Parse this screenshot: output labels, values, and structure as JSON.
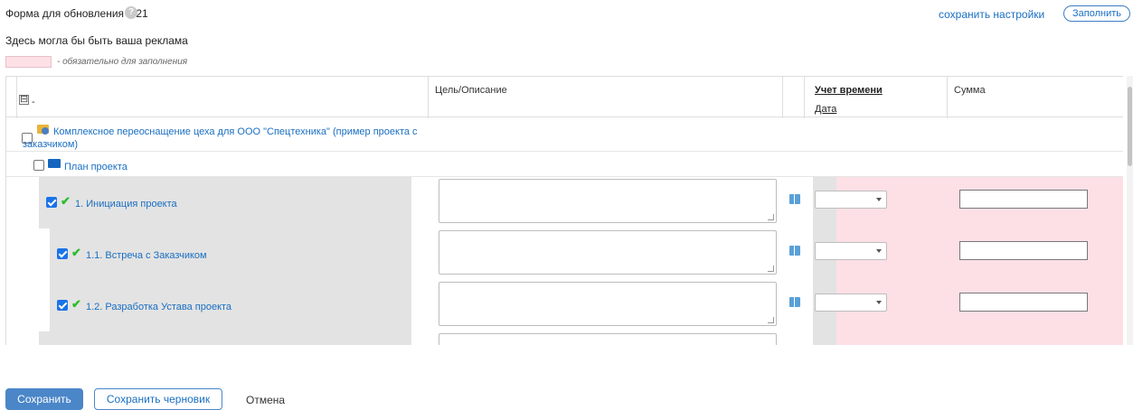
{
  "header": {
    "title": "Форма для обновления 3.21",
    "help_icon": "?",
    "save_settings_link": "сохранить настройки",
    "fill_button": "Заполнить",
    "ad_text": "Здесь могла бы быть ваша реклама",
    "required_note": "- обязательно для заполнения",
    "required_color": "#fde0e6"
  },
  "table": {
    "columns": {
      "toggle": "⊟",
      "first": "-",
      "goal": "Цель/Описание",
      "time": "Учет времени",
      "date": "Дата",
      "sum": "Сумма"
    },
    "project": {
      "label": "Комплексное переоснащение цеха для ООО \"Спецтехника\" (пример проекта с заказчиком)",
      "checked": false
    },
    "plan": {
      "label": "План проекта",
      "checked": false
    },
    "tasks": [
      {
        "label": "1. Инициация проекта",
        "checked": true
      },
      {
        "label": "1.1. Встреча с Заказчиком",
        "checked": true
      },
      {
        "label": "1.2. Разработка Устава проекта",
        "checked": true
      }
    ]
  },
  "footer": {
    "save_label": "Сохранить",
    "save_draft_label": "Сохранить черновик",
    "cancel_label": "Отмена"
  },
  "colors": {
    "accent": "#1a6fc2",
    "primary_button": "#4a86c8",
    "row_gray": "#e3e3e3",
    "required_pink": "#fde0e6",
    "check_green": "#2bbd2b"
  }
}
